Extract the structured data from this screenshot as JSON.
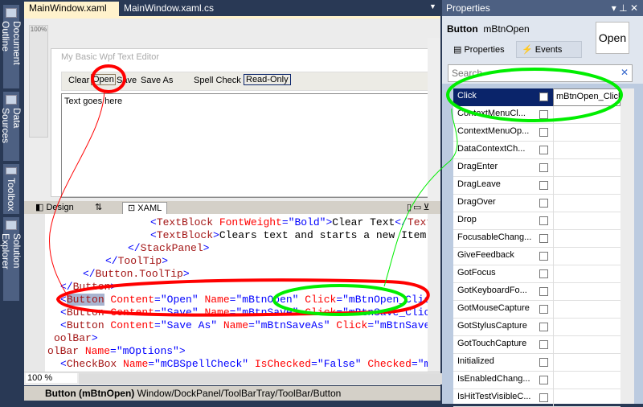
{
  "sidebar": {
    "items": [
      {
        "label": "Document Outline",
        "icon": "document-outline-icon"
      },
      {
        "label": "Data Sources",
        "icon": "data-sources-icon"
      },
      {
        "label": "Toolbox",
        "icon": "toolbox-icon"
      },
      {
        "label": "Solution Explorer",
        "icon": "solution-explorer-icon"
      }
    ]
  },
  "doc_tabs": [
    {
      "label": "MainWindow.xaml",
      "active": true
    },
    {
      "label": "MainWindow.xaml.cs",
      "active": false
    }
  ],
  "designer": {
    "zoom": "100%",
    "window_title": "My Basic Wpf Text Editor",
    "toolbar1": [
      "Clear",
      "Open",
      "Save",
      "Save As"
    ],
    "toolbar2": [
      "Spell Check",
      "Read-Only"
    ],
    "text": "Text goes here"
  },
  "view_tabs": {
    "design": "Design",
    "swap": "⇅",
    "xaml": "XAML"
  },
  "code_lines": [
    [
      [
        "<",
        "b"
      ],
      [
        "TextBlock",
        "m"
      ],
      [
        " FontWeight",
        "r"
      ],
      [
        "=\"Bold\">",
        "b"
      ],
      [
        "Clear Text",
        "t"
      ],
      [
        "</",
        "b"
      ],
      [
        "TextBlock",
        "m"
      ]
    ],
    [
      [
        "<",
        "b"
      ],
      [
        "TextBlock",
        "m"
      ],
      [
        ">",
        "b"
      ],
      [
        "Clears text and starts a new Item.",
        "t"
      ],
      [
        "</",
        "b"
      ],
      [
        "Te",
        "m"
      ]
    ],
    [
      [
        "</",
        "b"
      ],
      [
        "StackPanel",
        "m"
      ],
      [
        ">",
        "b"
      ]
    ],
    [
      [
        "</",
        "b"
      ],
      [
        "ToolTip",
        "m"
      ],
      [
        ">",
        "b"
      ]
    ],
    [
      [
        "</",
        "b"
      ],
      [
        "Button.ToolTip",
        "m"
      ],
      [
        ">",
        "b"
      ]
    ],
    [
      [
        "</",
        "b"
      ],
      [
        "Button",
        "m"
      ],
      [
        ">",
        "b"
      ]
    ],
    [
      [
        "<",
        "b"
      ],
      [
        "Button",
        "ms"
      ],
      [
        " Content",
        "r"
      ],
      [
        "=\"Open\"",
        "b"
      ],
      [
        " Name",
        "r"
      ],
      [
        "=\"mBtnOpen\"",
        "b"
      ],
      [
        " Click",
        "r"
      ],
      [
        "=\"mBtnOpen_Click\"",
        "b"
      ],
      [
        " </",
        "b"
      ],
      [
        "B",
        "m"
      ]
    ],
    [
      [
        "<",
        "b"
      ],
      [
        "Button",
        "m"
      ],
      [
        " Content",
        "r"
      ],
      [
        "=\"Save\"",
        "b"
      ],
      [
        " Name",
        "r"
      ],
      [
        "=\"mBtnSave\"",
        "b"
      ],
      [
        " Click",
        "r"
      ],
      [
        "=\"mBtnSave_Click\"",
        "b"
      ],
      [
        "></",
        "b"
      ],
      [
        "B",
        "m"
      ]
    ],
    [
      [
        "<",
        "b"
      ],
      [
        "Button",
        "m"
      ],
      [
        " Content",
        "r"
      ],
      [
        "=\"Save As\"",
        "b"
      ],
      [
        " Name",
        "r"
      ],
      [
        "=\"mBtnSaveAs\"",
        "b"
      ],
      [
        " Click",
        "r"
      ],
      [
        "=\"mBtnSaveAs_Cli",
        "b"
      ]
    ],
    [
      [
        "oolBar",
        "m"
      ],
      [
        ">",
        "b"
      ]
    ],
    [
      [
        "olBar",
        "m"
      ],
      [
        " Name",
        "r"
      ],
      [
        "=\"mOptions\"",
        "b"
      ],
      [
        ">",
        "b"
      ]
    ],
    [
      [
        "<",
        "b"
      ],
      [
        "CheckBox",
        "m"
      ],
      [
        " Name",
        "r"
      ],
      [
        "=\"mCBSpellCheck\"",
        "b"
      ],
      [
        " IsChecked",
        "r"
      ],
      [
        "=\"False\"",
        "b"
      ],
      [
        " Checked",
        "r"
      ],
      [
        "=\"mCBSpel",
        "b"
      ]
    ]
  ],
  "zoom_select": "100 %",
  "status": {
    "element": "Button (mBtnOpen)",
    "path": "Window/DockPanel/ToolBarTray/ToolBar/Button"
  },
  "properties": {
    "title": "Properties",
    "type": "Button",
    "name": "mBtnOpen",
    "preview": "Open",
    "tabs": [
      {
        "label": "Properties",
        "active": false
      },
      {
        "label": "Events",
        "active": true
      }
    ],
    "search_placeholder": "Search",
    "events": [
      {
        "name": "Click",
        "value": "mBtnOpen_Click",
        "selected": true
      },
      {
        "name": "ContextMenuCl..."
      },
      {
        "name": "ContextMenuOp..."
      },
      {
        "name": "DataContextCh..."
      },
      {
        "name": "DragEnter"
      },
      {
        "name": "DragLeave"
      },
      {
        "name": "DragOver"
      },
      {
        "name": "Drop"
      },
      {
        "name": "FocusableChang..."
      },
      {
        "name": "GiveFeedback"
      },
      {
        "name": "GotFocus"
      },
      {
        "name": "GotKeyboardFo..."
      },
      {
        "name": "GotMouseCapture"
      },
      {
        "name": "GotStylusCapture"
      },
      {
        "name": "GotTouchCapture"
      },
      {
        "name": "Initialized"
      },
      {
        "name": "IsEnabledChang..."
      },
      {
        "name": "IsHitTestVisibleC..."
      }
    ]
  },
  "colors": {
    "chrome": "#293955",
    "tab_active": "#fff2cc",
    "selection": "#0a246a",
    "annotation_red": "#ff0000",
    "annotation_green": "#00ee00"
  }
}
